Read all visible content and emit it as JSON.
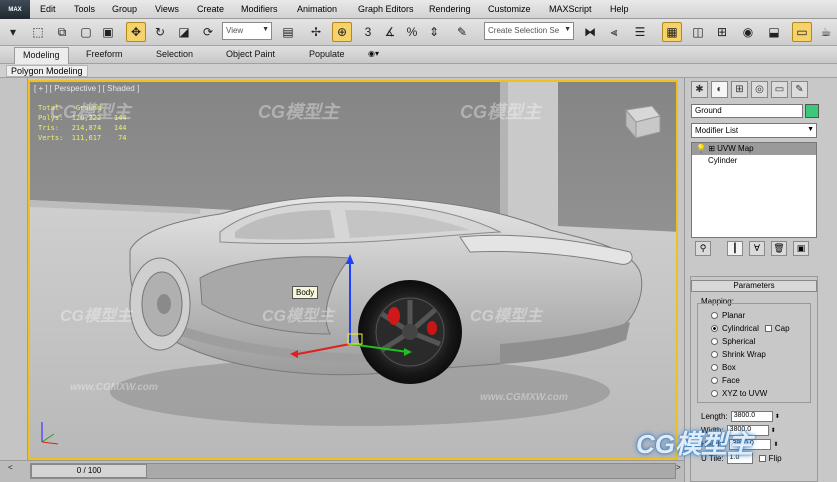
{
  "app": {
    "logo_text": "MAX"
  },
  "menu": {
    "items": [
      "Edit",
      "Tools",
      "Group",
      "Views",
      "Create",
      "Modifiers",
      "Animation",
      "Graph Editors",
      "Rendering",
      "Customize",
      "MAXScript",
      "Help"
    ]
  },
  "toolbar": {
    "view_dropdown": "View",
    "selection_set_placeholder": "Create Selection Se"
  },
  "ribbon": {
    "tabs": [
      "Modeling",
      "Freeform",
      "Selection",
      "Object Paint",
      "Populate"
    ],
    "panel_label": "Polygon Modeling"
  },
  "viewport": {
    "label": "[ + ] [ Perspective ] [ Shaded ]",
    "stats": {
      "header": "Total    Ground",
      "polys": "Polys:  120,222   144",
      "tris": "Tris:   214,874   144",
      "verts": "Verts:  111,617    74"
    },
    "tooltip": "Body",
    "watermarks": [
      "CG模型主",
      "CG模型主",
      "CG模型主",
      "CG模型主",
      "CG模型主",
      "CG模型主",
      "www.CGMXW.com",
      "www.CGMXW.com"
    ]
  },
  "command_panel": {
    "object_name": "Ground",
    "object_color": "#3cc87a",
    "modifier_list": "Modifier List",
    "stack": [
      "UVW Map",
      "Cylinder"
    ],
    "parameters": {
      "title": "Parameters",
      "mapping_label": "Mapping:",
      "options": [
        "Planar",
        "Cylindrical",
        "Spherical",
        "Shrink Wrap",
        "Box",
        "Face",
        "XYZ to UVW"
      ],
      "selected": "Cylindrical",
      "cap_label": "Cap",
      "length_label": "Length:",
      "length_value": "3800.0",
      "width_label": "Width:",
      "width_value": "3800.0",
      "height_label": "Height:",
      "height_value": "3800.0",
      "utile_label": "U Tile:",
      "utile_value": "1.0",
      "flip_label": "Flip"
    }
  },
  "timeline": {
    "position": "0 / 100",
    "prev": "<",
    "next": ">"
  },
  "corner_logo": "CG模型主",
  "accent_color": "#f0c020"
}
